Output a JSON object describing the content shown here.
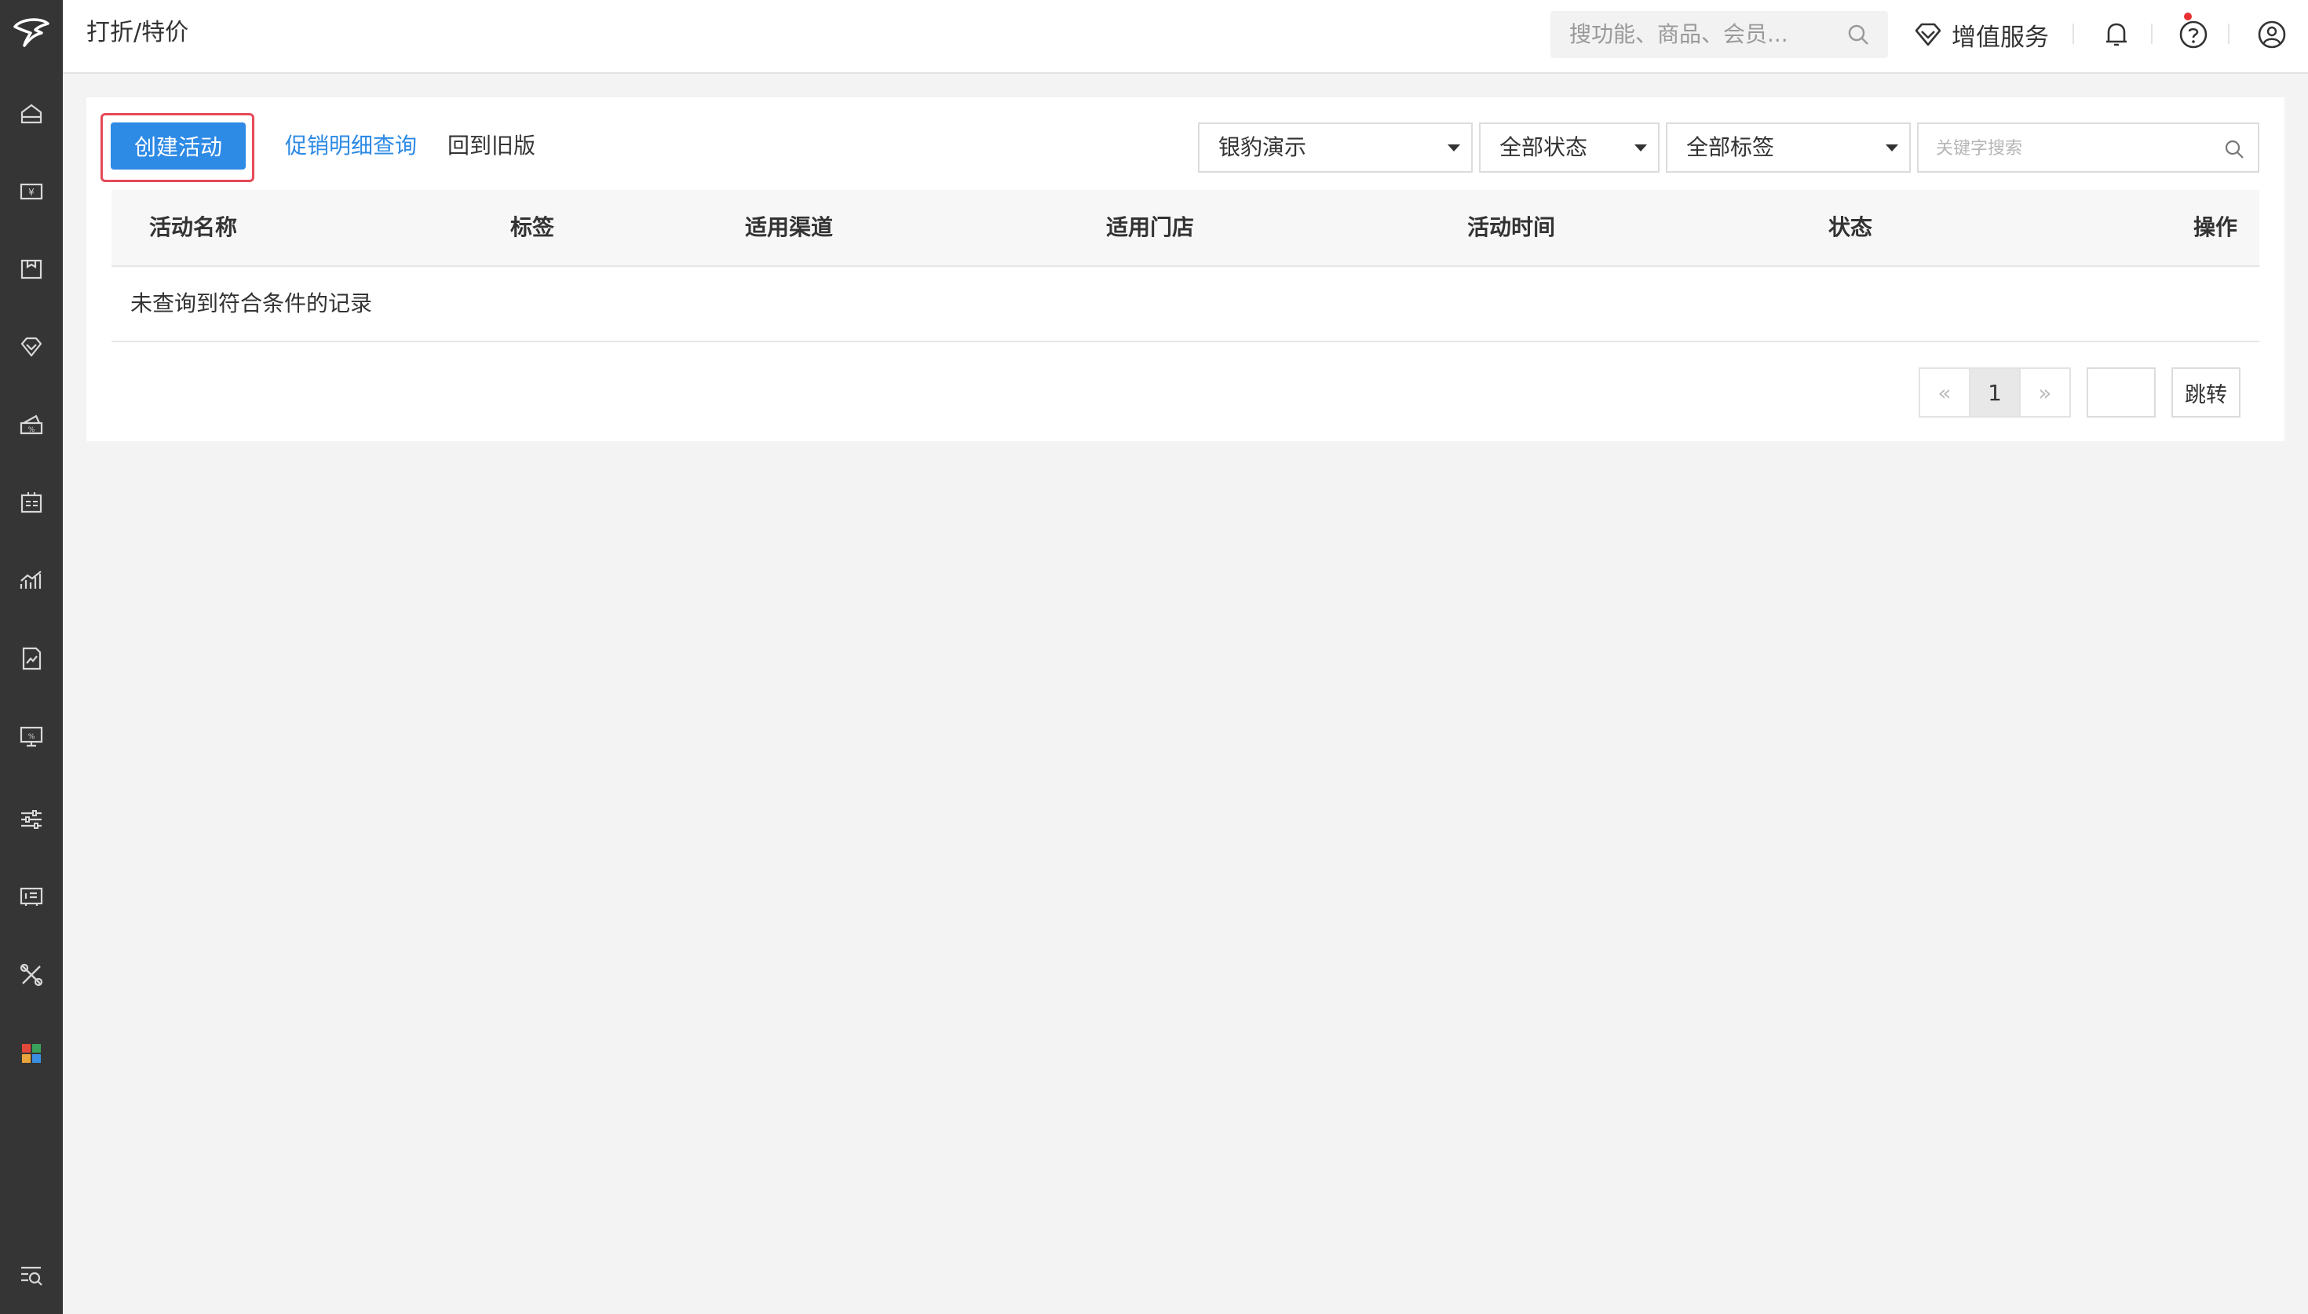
{
  "header": {
    "page_title": "打折/特价",
    "search_placeholder": "搜功能、商品、会员...",
    "value_added_service": "增值服务",
    "has_notification": true
  },
  "sidebar": {
    "items": [
      {
        "name": "home-icon"
      },
      {
        "name": "cashier-icon"
      },
      {
        "name": "goods-icon"
      },
      {
        "name": "member-icon"
      },
      {
        "name": "promotion-icon"
      },
      {
        "name": "card-icon"
      },
      {
        "name": "analytics-icon"
      },
      {
        "name": "report-icon"
      },
      {
        "name": "monitor-icon"
      },
      {
        "name": "settings-sliders-icon"
      },
      {
        "name": "device-icon"
      },
      {
        "name": "tools-icon"
      },
      {
        "name": "apps-icon"
      }
    ],
    "bottom": {
      "name": "search-menu-icon"
    },
    "colors": {
      "background": "#353535",
      "icon": "#d8d8d8"
    }
  },
  "toolbar": {
    "create_label": "创建活动",
    "detail_link": "促销明细查询",
    "old_version_link": "回到旧版",
    "store_select": "银豹演示",
    "status_select": "全部状态",
    "tag_select": "全部标签",
    "keyword_placeholder": "关键字搜索"
  },
  "table": {
    "columns": [
      "活动名称",
      "标签",
      "适用渠道",
      "适用门店",
      "活动时间",
      "状态",
      "操作"
    ],
    "rows": [],
    "empty_text": "未查询到符合条件的记录"
  },
  "pagination": {
    "prev": "«",
    "current": "1",
    "next": "»",
    "jump_label": "跳转"
  },
  "colors": {
    "accent": "#2d8ae5",
    "highlight_border": "#e54a5a",
    "notification_dot": "#e63232"
  }
}
